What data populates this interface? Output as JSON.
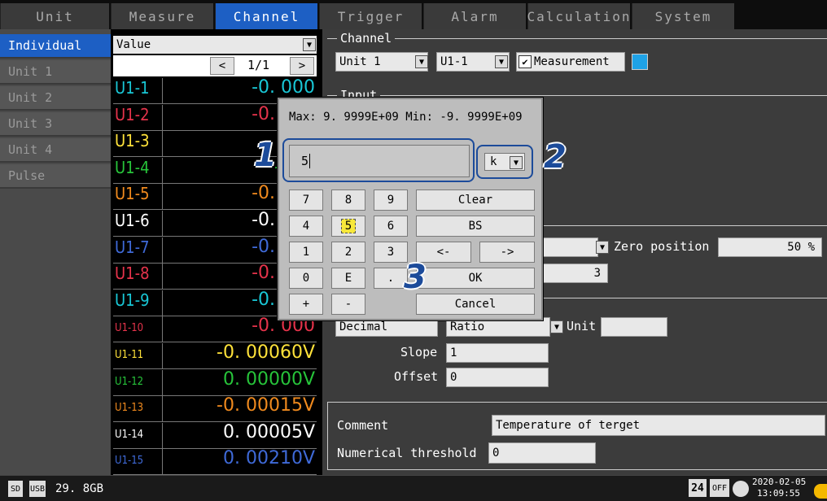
{
  "tabs": [
    "Unit",
    "Measure",
    "Channel",
    "Trigger",
    "Alarm",
    "Calculation",
    "System"
  ],
  "sidebar": [
    "Individual",
    "Unit 1",
    "Unit 2",
    "Unit 3",
    "Unit 4",
    "Pulse"
  ],
  "list": {
    "header": "Value",
    "prev": "<",
    "next": ">",
    "page": "1/1",
    "rows": [
      {
        "id": "U1-1",
        "val": "-0. 000",
        "color": "#19c7d6"
      },
      {
        "id": "U1-2",
        "val": "-0. 004",
        "color": "#e5334b"
      },
      {
        "id": "U1-3",
        "val": "-0",
        "color": "#ffe23a"
      },
      {
        "id": "U1-4",
        "val": "-0. 0",
        "color": "#27c43a"
      },
      {
        "id": "U1-5",
        "val": "-0. 003",
        "color": "#f08a1e"
      },
      {
        "id": "U1-6",
        "val": "-0. 003",
        "color": "#ffffff"
      },
      {
        "id": "U1-7",
        "val": "-0. 002",
        "color": "#3f6ad8"
      },
      {
        "id": "U1-8",
        "val": "-0. 002",
        "color": "#e5334b"
      },
      {
        "id": "U1-9",
        "val": "-0. 001",
        "color": "#19c7d6"
      },
      {
        "id": "U1-10",
        "val": "-0. 000",
        "color": "#e5334b"
      },
      {
        "id": "U1-11",
        "val": "-0. 00060V",
        "color": "#ffe23a"
      },
      {
        "id": "U1-12",
        "val": "0. 00000V",
        "color": "#27c43a"
      },
      {
        "id": "U1-13",
        "val": "-0. 00015V",
        "color": "#f08a1e"
      },
      {
        "id": "U1-14",
        "val": "0. 00005V",
        "color": "#ffffff"
      },
      {
        "id": "U1-15",
        "val": "0. 00210V",
        "color": "#3f6ad8"
      }
    ]
  },
  "panel": {
    "channel_group": "Channel",
    "unit": "Unit 1",
    "channel": "U1-1",
    "measurement_label": "Measurement",
    "measurement_color": "#1fa2e6",
    "input_group": "Input",
    "zero_position_label": "Zero position",
    "zero_position_value": "50 %",
    "field_three": "3",
    "decimal": "Decimal",
    "ratio": "Ratio",
    "unit_label": "Unit",
    "slope_label": "Slope",
    "slope_value": "1",
    "offset_label": "Offset",
    "offset_value": "0",
    "comment_label": "Comment",
    "comment_value": "Temperature of terget",
    "threshold_label": "Numerical threshold",
    "threshold_value": "0"
  },
  "dialog": {
    "range": "Max: 9. 9999E+09 Min: -9. 9999E+09",
    "input": "5",
    "unit_prefix": "k",
    "keys": {
      "k7": "7",
      "k8": "8",
      "k9": "9",
      "clear": "Clear",
      "k4": "4",
      "k5": "5",
      "k6": "6",
      "bs": "BS",
      "k1": "1",
      "k2": "2",
      "k3": "3",
      "left": "<-",
      "right": "->",
      "k0": "0",
      "e": "E",
      "dot": ".",
      "ok": "OK",
      "plus": "+",
      "minus": "-",
      "cancel": "Cancel"
    },
    "callouts": [
      "1",
      "2",
      "3"
    ]
  },
  "status": {
    "storage": "29. 8GB",
    "sd_label": "SD",
    "usb_label": "USB",
    "box_24": "24",
    "box_off": "OFF",
    "date": "2020-02-05",
    "time": "13:09:55"
  }
}
